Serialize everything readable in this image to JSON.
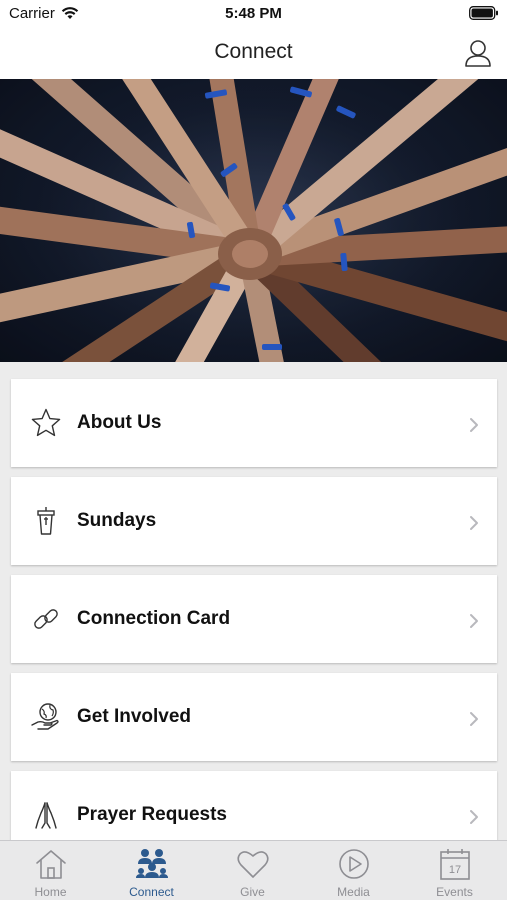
{
  "status_bar": {
    "carrier": "Carrier",
    "time": "5:48 PM"
  },
  "header": {
    "title": "Connect"
  },
  "menu": [
    {
      "label": "About Us",
      "icon": "star-icon"
    },
    {
      "label": "Sundays",
      "icon": "pulpit-icon"
    },
    {
      "label": "Connection Card",
      "icon": "link-icon"
    },
    {
      "label": "Get Involved",
      "icon": "globe-hand-icon"
    },
    {
      "label": "Prayer Requests",
      "icon": "praying-hands-icon"
    }
  ],
  "tabs": [
    {
      "label": "Home",
      "icon": "home-icon",
      "active": false
    },
    {
      "label": "Connect",
      "icon": "people-icon",
      "active": true
    },
    {
      "label": "Give",
      "icon": "heart-icon",
      "active": false
    },
    {
      "label": "Media",
      "icon": "play-icon",
      "active": false
    },
    {
      "label": "Events",
      "icon": "calendar-icon",
      "active": false
    }
  ],
  "calendar_day": "17",
  "colors": {
    "active_tab": "#2c5a8e",
    "inactive_tab": "#8e8e93",
    "background": "#ececec"
  }
}
